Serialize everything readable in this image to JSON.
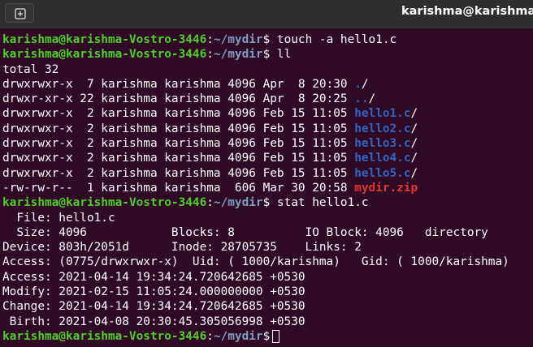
{
  "window": {
    "title": "karishma@karishma-V",
    "new_tab_icon": "new-tab-icon"
  },
  "prompt": {
    "user_host": "karishma@karishma-Vostro-3446",
    "colon": ":",
    "path": "~/mydir",
    "symbol": "$"
  },
  "commands": {
    "touch": " touch -a hello1.c",
    "ll": " ll",
    "stat": " stat hello1.c"
  },
  "listing": {
    "total": "total 32",
    "rows": [
      {
        "info": "drwxrwxr-x  7 karishma karishma 4096 Apr  8 20:30 ",
        "name": ".",
        "suffix": "/"
      },
      {
        "info": "drwxr-xr-x 22 karishma karishma 4096 Apr  8 20:25 ",
        "name": "..",
        "suffix": "/"
      },
      {
        "info": "drwxrwxr-x  2 karishma karishma 4096 Feb 15 11:05 ",
        "name": "hello1.c",
        "suffix": "/"
      },
      {
        "info": "drwxrwxr-x  2 karishma karishma 4096 Feb 15 11:05 ",
        "name": "hello2.c",
        "suffix": "/"
      },
      {
        "info": "drwxrwxr-x  2 karishma karishma 4096 Feb 15 11:05 ",
        "name": "hello3.c",
        "suffix": "/"
      },
      {
        "info": "drwxrwxr-x  2 karishma karishma 4096 Feb 15 11:05 ",
        "name": "hello4.c",
        "suffix": "/"
      },
      {
        "info": "drwxrwxr-x  2 karishma karishma 4096 Feb 15 11:05 ",
        "name": "hello5.c",
        "suffix": "/"
      },
      {
        "info": "-rw-rw-r--  1 karishma karishma  606 Mar 30 20:58 ",
        "name": "mydir.zip",
        "suffix": ""
      }
    ]
  },
  "stat_output": [
    "  File: hello1.c",
    "  Size: 4096            Blocks: 8          IO Block: 4096   directory",
    "Device: 803h/2051d      Inode: 28705735    Links: 2",
    "Access: (0775/drwxrwxr-x)  Uid: ( 1000/karishma)   Gid: ( 1000/karishma)",
    "Access: 2021-04-14 19:34:24.720642685 +0530",
    "Modify: 2021-02-15 11:05:24.000000000 +0530",
    "Change: 2021-04-14 19:34:24.720642685 +0530",
    " Birth: 2021-04-08 20:30:45.305056998 +0530"
  ],
  "colors": {
    "background": "#300a24",
    "prompt_user": "#4ed028",
    "prompt_path": "#7f9ec7",
    "directory": "#2f65c4",
    "archive": "#e03535"
  }
}
